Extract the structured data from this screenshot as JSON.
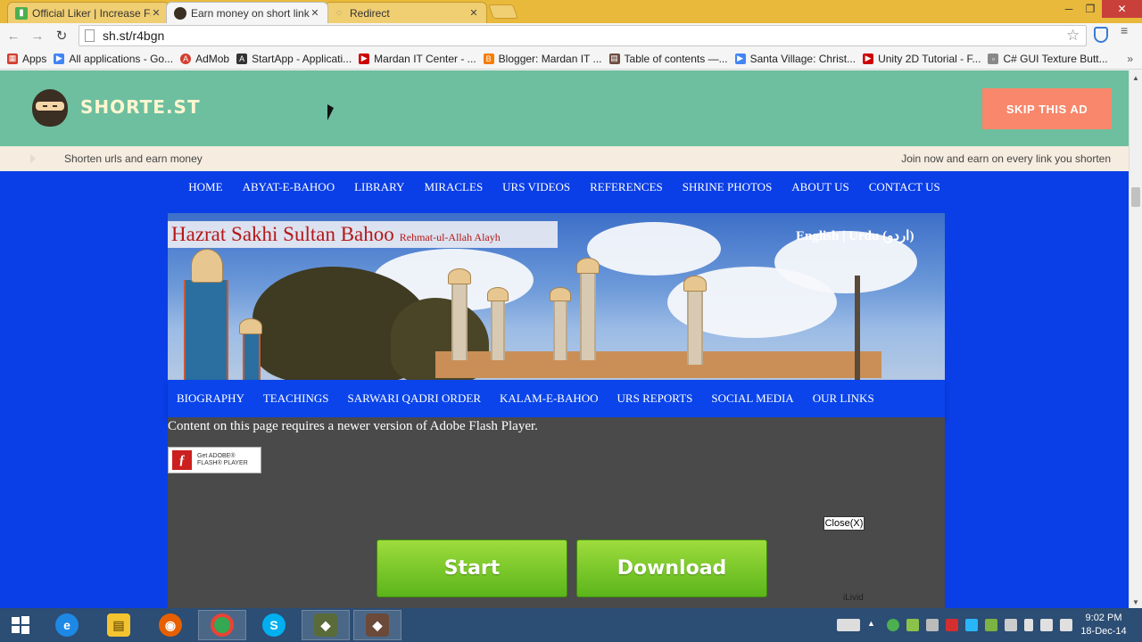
{
  "browser": {
    "tabs": [
      {
        "title": "Official Liker | Increase Fa",
        "active": false,
        "color": "#4caf50"
      },
      {
        "title": "Earn money on short links",
        "active": true,
        "color": "#3b2e22"
      },
      {
        "title": "Redirect",
        "active": false,
        "color": "#999999"
      }
    ],
    "window_controls": {
      "minimize": "─",
      "restore": "❐",
      "close": "✕"
    },
    "url": "sh.st/r4bgn",
    "bookmarks": [
      {
        "label": "Apps",
        "icon": "apps-grid-icon",
        "color": "#d23f31"
      },
      {
        "label": "All applications - Go...",
        "icon": "play-store-icon",
        "color": "#4285f4"
      },
      {
        "label": "AdMob",
        "icon": "admob-icon",
        "color": "#d23f31"
      },
      {
        "label": "StartApp - Applicati...",
        "icon": "startapp-icon",
        "color": "#333333"
      },
      {
        "label": "Mardan IT Center - ...",
        "icon": "youtube-icon",
        "color": "#cc0000"
      },
      {
        "label": "Blogger: Mardan IT ...",
        "icon": "blogger-icon",
        "color": "#f57d00"
      },
      {
        "label": "Table of contents —...",
        "icon": "book-icon",
        "color": "#6d4c41"
      },
      {
        "label": "Santa Village: Christ...",
        "icon": "play-store-icon",
        "color": "#4285f4"
      },
      {
        "label": "Unity 2D Tutorial - F...",
        "icon": "youtube-icon",
        "color": "#cc0000"
      },
      {
        "label": "C# GUI Texture Butt...",
        "icon": "page-icon",
        "color": "#888888"
      }
    ],
    "bookmarks_more": "»"
  },
  "ad": {
    "logo_text": "SHORTE.ST",
    "skip_label": "SKIP THIS AD",
    "strip_left": "Shorten urls and earn money",
    "strip_right": "Join now and earn on every link you shorten",
    "accent_color": "#6dbf9f",
    "skip_color": "#f8876b"
  },
  "site": {
    "top_nav": [
      "HOME",
      "ABYAT-E-BAHOO",
      "LIBRARY",
      "MIRACLES",
      "URS VIDEOS",
      "REFERENCES",
      "SHRINE PHOTOS",
      "ABOUT US",
      "CONTACT US"
    ],
    "title_main": "Hazrat Sakhi Sultan Bahoo",
    "title_sub": "Rehmat-ul-Allah Alayh",
    "language_switch": "English | Urdu (اردو)",
    "sub_nav": [
      "BIOGRAPHY",
      "TEACHINGS",
      "SARWARI QADRI ORDER",
      "KALAM-E-BAHOO",
      "URS REPORTS",
      "SOCIAL MEDIA",
      "OUR LINKS"
    ],
    "flash_message": "Content on this page requires a newer version of Adobe Flash Player.",
    "flash_button_line1": "Get ADOBE®",
    "flash_button_line2": "FLASH® PLAYER",
    "background_color": "#0a3ee6"
  },
  "popup": {
    "close_label": "Close(X)",
    "start_label": "Start",
    "download_label": "Download",
    "brand": "iLivid"
  },
  "taskbar": {
    "apps": [
      {
        "name": "internet-explorer",
        "color": "#1e88e5",
        "glyph": "e"
      },
      {
        "name": "file-explorer",
        "color": "#f4c430",
        "glyph": "▤"
      },
      {
        "name": "firefox",
        "color": "#e66000",
        "glyph": "◉"
      },
      {
        "name": "chrome",
        "color": "#34a853",
        "glyph": "◎"
      },
      {
        "name": "skype",
        "color": "#00aff0",
        "glyph": "S"
      },
      {
        "name": "app-one",
        "color": "#5a6b3a",
        "glyph": "◆"
      },
      {
        "name": "app-two",
        "color": "#6b4a3a",
        "glyph": "◆"
      }
    ],
    "time": "9:02 PM",
    "date": "18-Dec-14"
  }
}
